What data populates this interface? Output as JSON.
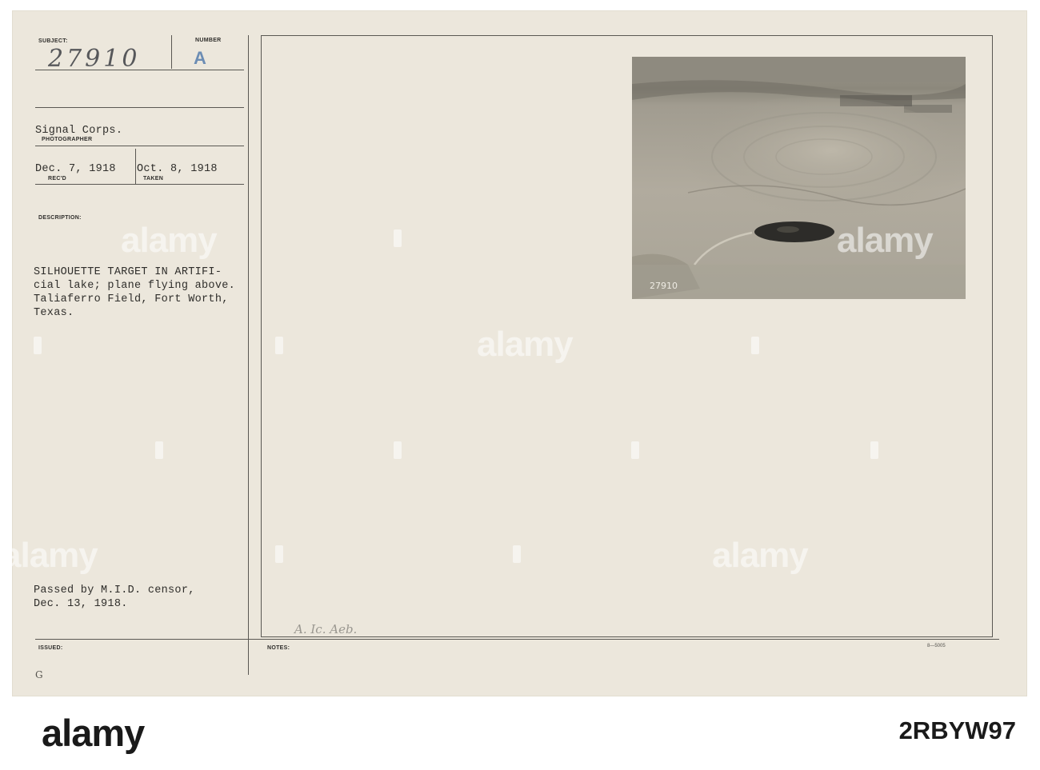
{
  "card": {
    "labels": {
      "subject": "SUBJECT:",
      "number": "NUMBER",
      "photographer": "PHOTOGRAPHER",
      "recd": "REC'D",
      "taken": "TAKEN",
      "description": "DESCRIPTION:",
      "issued": "ISSUED:",
      "notes": "NOTES:"
    },
    "subject_number": "27910",
    "number_letter": "A",
    "photographer": "Signal Corps.",
    "received_date": "Dec. 7, 1918",
    "taken_date": "Oct. 8, 1918",
    "description_lines": [
      "SILHOUETTE TARGET IN ARTIFI-",
      "cial lake; plane flying above.",
      "Taliaferro Field, Fort Worth,",
      "Texas."
    ],
    "censor_lines": [
      "Passed by M.I.D. censor,",
      "Dec. 13, 1918."
    ],
    "notes_handwritten": "A. Ic. Aeb.",
    "form_code": "8—5005",
    "corner_letter": "G",
    "photo_inscription": "27910"
  },
  "watermark": "alamy",
  "footer": {
    "brand": "alamy",
    "image_id": "2RBYW97"
  }
}
